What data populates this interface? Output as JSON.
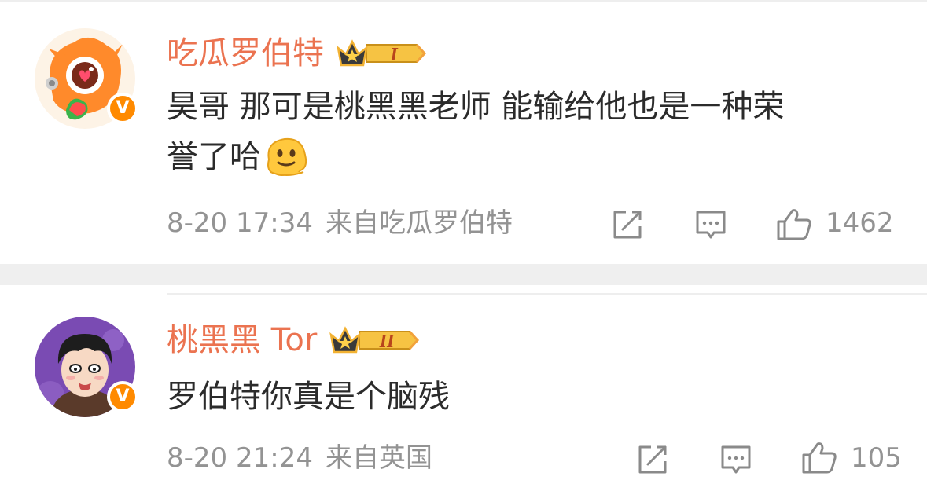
{
  "comments": [
    {
      "username": "吃瓜罗伯特",
      "vip_level": "I",
      "text": "昊哥 那可是桃黑黑老师 能输给他也是一种荣\n誉了哈",
      "emoji_icon": "melting-face-emoji",
      "time": "8-20 17:34",
      "source": "来自吃瓜罗伯特",
      "likes": "1462",
      "verified_badge": "V",
      "avatar_icon": "orange-cartoon-creature-avatar"
    },
    {
      "username": "桃黑黑 Tor",
      "vip_level": "II",
      "text": "罗伯特你真是个脑残",
      "time": "8-20 21:24",
      "source": "来自英国",
      "likes": "105",
      "verified_badge": "V",
      "avatar_icon": "cartoon-boy-avatar"
    }
  ],
  "icons": {
    "repost": "share-edit-icon",
    "comment": "comment-bubble-icon",
    "like": "thumbs-up-icon"
  },
  "colors": {
    "username": "#eb7350",
    "text": "#2b2b2b",
    "meta": "#939393",
    "verified": "#ff8a00",
    "vip_gold": "#f6c343"
  }
}
